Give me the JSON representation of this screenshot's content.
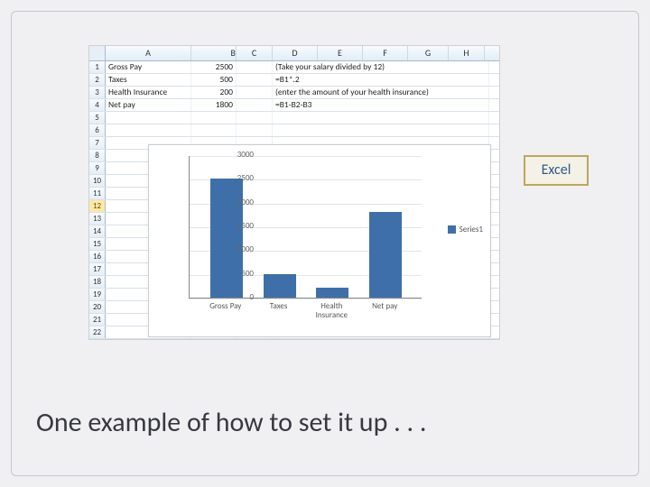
{
  "tag": "Excel",
  "caption": "One example of how to set it up . . .",
  "columns": [
    "A",
    "B",
    "C",
    "D",
    "E",
    "F",
    "G",
    "H"
  ],
  "selected_row": 12,
  "rows": [
    {
      "n": 1,
      "a": "Gross Pay",
      "b": "2500",
      "note": "(Take your salary divided by 12)"
    },
    {
      "n": 2,
      "a": "Taxes",
      "b": "500",
      "note": "=B1*.2"
    },
    {
      "n": 3,
      "a": "Health Insurance",
      "b": "200",
      "note": "(enter the amount of your health insurance)"
    },
    {
      "n": 4,
      "a": "Net pay",
      "b": "1800",
      "note": "=B1-B2-B3"
    },
    {
      "n": 5
    },
    {
      "n": 6
    },
    {
      "n": 7
    },
    {
      "n": 8
    },
    {
      "n": 9
    },
    {
      "n": 10
    },
    {
      "n": 11
    },
    {
      "n": 12
    },
    {
      "n": 13
    },
    {
      "n": 14
    },
    {
      "n": 15
    },
    {
      "n": 16
    },
    {
      "n": 17
    },
    {
      "n": 18
    },
    {
      "n": 19
    },
    {
      "n": 20
    },
    {
      "n": 21
    },
    {
      "n": 22
    }
  ],
  "chart_data": {
    "type": "bar",
    "categories": [
      "Gross Pay",
      "Taxes",
      "Health Insurance",
      "Net pay"
    ],
    "values": [
      2500,
      500,
      200,
      1800
    ],
    "series_name": "Series1",
    "ylim": [
      0,
      3000
    ],
    "yticks": [
      0,
      500,
      1000,
      1500,
      2000,
      2500,
      3000
    ],
    "title": "",
    "xlabel": "",
    "ylabel": ""
  },
  "colors": {
    "bar": "#3f6fa8"
  }
}
